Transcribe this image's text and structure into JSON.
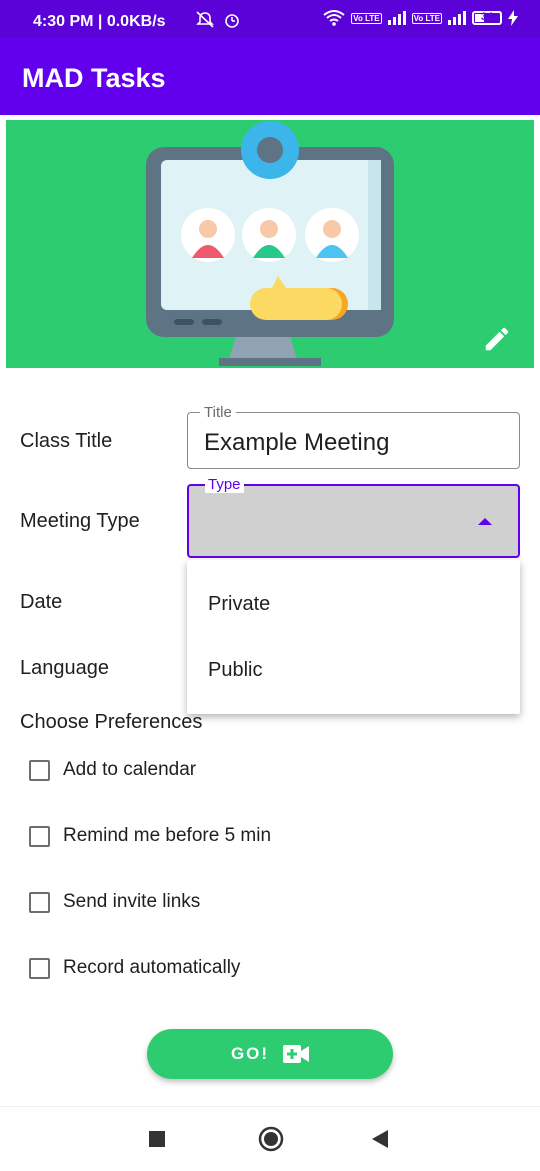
{
  "status_bar": {
    "time": "4:30 PM | 0.0KB/s",
    "battery": "34",
    "volte": "Vo LTE"
  },
  "app_bar": {
    "title": "MAD Tasks"
  },
  "colors": {
    "primary": "#6200ee",
    "status": "#5a02d8",
    "accent_green": "#2ecc71"
  },
  "form": {
    "class_title_label": "Class Title",
    "title_field": {
      "legend": "Title",
      "value": "Example Meeting"
    },
    "meeting_type_label": "Meeting Type",
    "type_field": {
      "legend": "Type",
      "value": ""
    },
    "date_label": "Date",
    "language_label": "Language",
    "dropdown_options": [
      "Private",
      "Public"
    ]
  },
  "preferences": {
    "heading": "Choose Preferences",
    "items": [
      {
        "label": "Add to calendar",
        "checked": false
      },
      {
        "label": "Remind me before 5 min",
        "checked": false
      },
      {
        "label": "Send invite links",
        "checked": false
      },
      {
        "label": "Record automatically",
        "checked": false
      }
    ]
  },
  "go_button": {
    "label": "GO!",
    "icon": "video-add-icon"
  },
  "icons": {
    "edit": "pencil-icon",
    "dropdown": "arrow-up-icon"
  }
}
